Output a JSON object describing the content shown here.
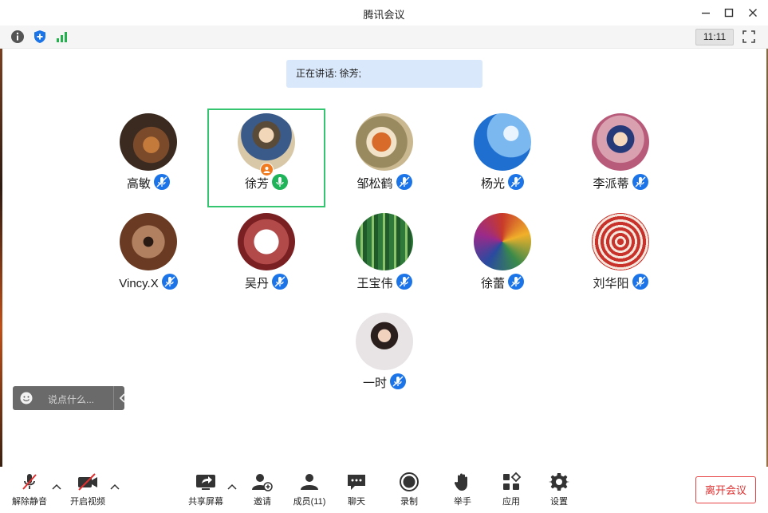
{
  "window": {
    "title": "腾讯会议"
  },
  "topbar": {
    "time": "11:11"
  },
  "speaking": {
    "text": "正在讲话: 徐芳;"
  },
  "participants": [
    {
      "name": "高敏",
      "mic": "muted"
    },
    {
      "name": "徐芳",
      "mic": "speaking",
      "active": true,
      "host": true
    },
    {
      "name": "邹松鹤",
      "mic": "muted"
    },
    {
      "name": "杨光",
      "mic": "muted"
    },
    {
      "name": "李派蒂",
      "mic": "muted"
    },
    {
      "name": "Vincy.X",
      "mic": "muted"
    },
    {
      "name": "吴丹",
      "mic": "muted"
    },
    {
      "name": "王宝伟",
      "mic": "muted"
    },
    {
      "name": "徐蕾",
      "mic": "muted"
    },
    {
      "name": "刘华阳",
      "mic": "muted"
    },
    {
      "name": "一时",
      "mic": "muted"
    }
  ],
  "chat": {
    "placeholder": "说点什么..."
  },
  "toolbar": {
    "unmute": "解除静音",
    "start_video": "开启视频",
    "share_screen": "共享屏幕",
    "invite": "邀请",
    "members": "成员(11)",
    "chat": "聊天",
    "record": "录制",
    "raise_hand": "举手",
    "apps": "应用",
    "settings": "设置",
    "leave": "离开会议"
  },
  "colors": {
    "accent_blue": "#1b74e8",
    "speaking_green": "#35c46f",
    "leave_red": "#e02f2f",
    "banner_bg": "#d9e8fb"
  }
}
